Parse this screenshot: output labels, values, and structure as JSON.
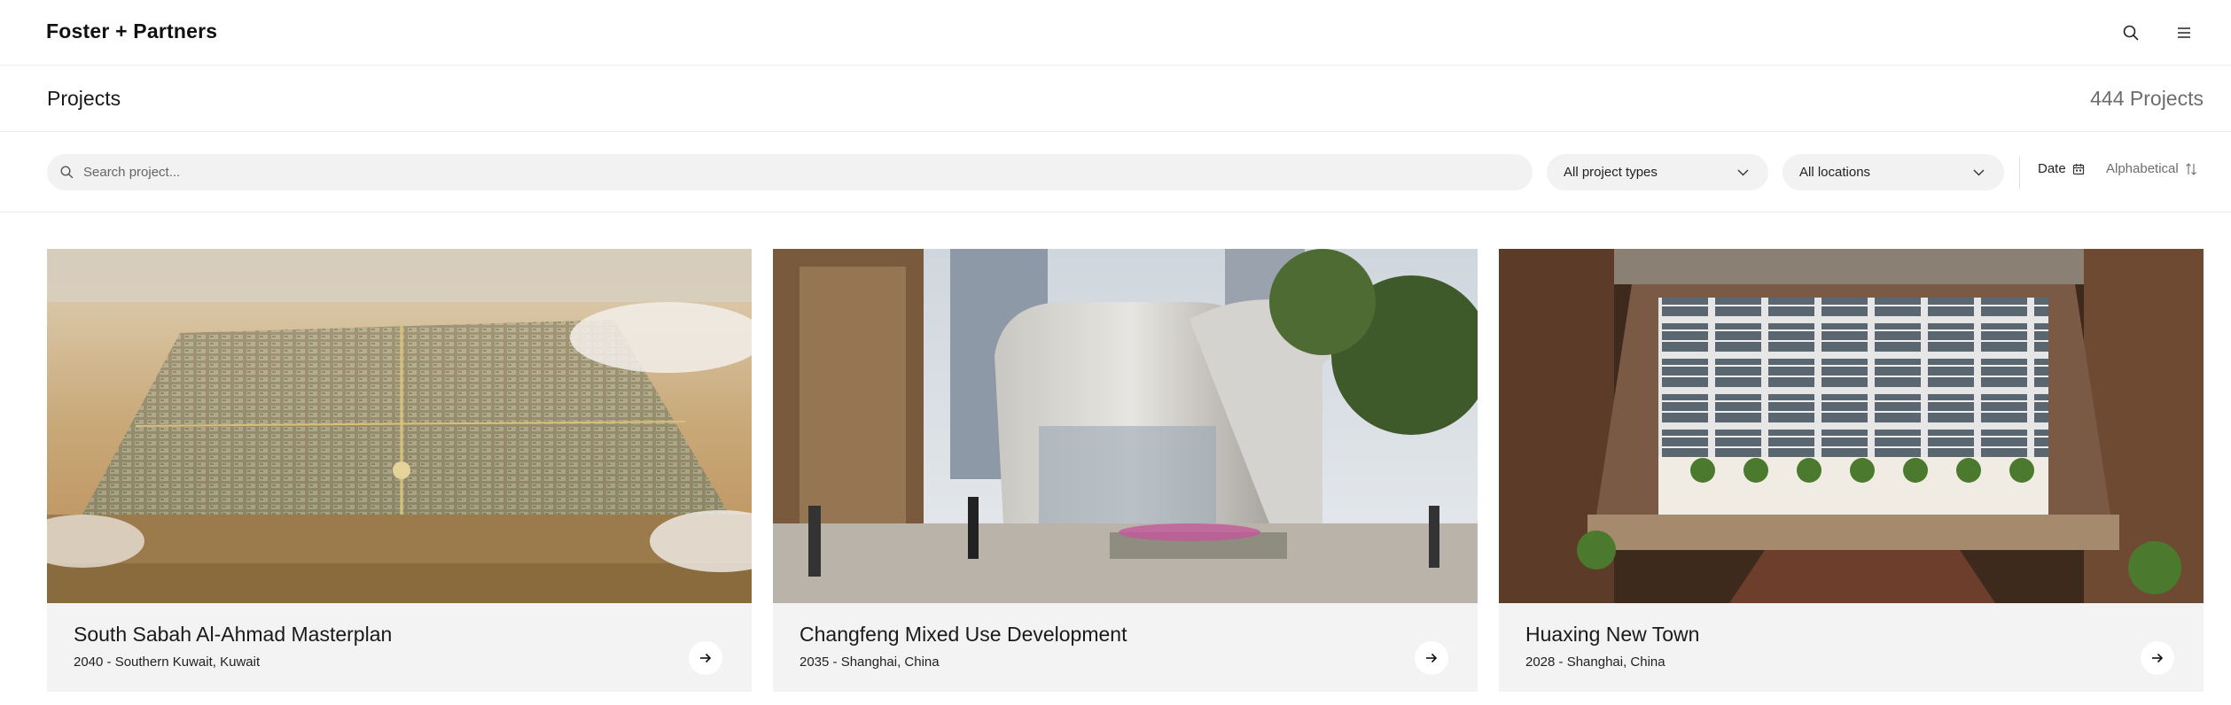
{
  "header": {
    "logo": "Foster + Partners",
    "search_icon": "search-icon",
    "menu_icon": "hamburger-menu-icon"
  },
  "titlebar": {
    "title": "Projects",
    "count": "444 Projects"
  },
  "filters": {
    "search_placeholder": "Search project...",
    "project_types": "All project types",
    "locations": "All locations",
    "sort_date": "Date",
    "sort_alpha": "Alphabetical"
  },
  "projects": [
    {
      "name": "South Sabah Al-Ahmad Masterplan",
      "meta": "2040 - Southern Kuwait, Kuwait"
    },
    {
      "name": "Changfeng Mixed Use Development",
      "meta": "2035 - Shanghai, China"
    },
    {
      "name": "Huaxing New Town",
      "meta": "2028 - Shanghai, China"
    }
  ],
  "colors": {
    "background": "#ffffff",
    "card_background": "#f3f3f3",
    "control_background": "#f2f2f2",
    "muted_text": "#6d6d6d"
  }
}
